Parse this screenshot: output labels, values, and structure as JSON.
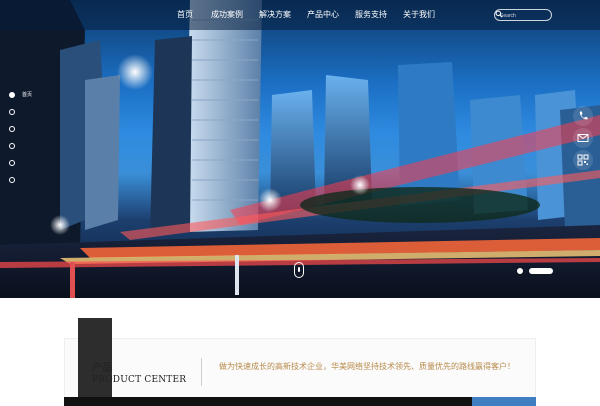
{
  "nav": {
    "items": [
      "首页",
      "成功案例",
      "解决方案",
      "产品中心",
      "服务支持",
      "关于我们"
    ],
    "search_placeholder": "Search"
  },
  "hero": {
    "dot_nav_active_label": "首页",
    "dot_count": 6,
    "slide_count": 2,
    "active_slide": 2
  },
  "product_center": {
    "title_cn": "产品",
    "title_en": "PRODUCT CENTER",
    "description": "做为快速成长的高新技术企业，华美网络坚持技术领先、质量优先的路线赢得客户！"
  },
  "colors": {
    "accent_blue": "#3f7fc1",
    "dark_box": "#2d2d2d",
    "desc_text": "#b88a4a"
  }
}
